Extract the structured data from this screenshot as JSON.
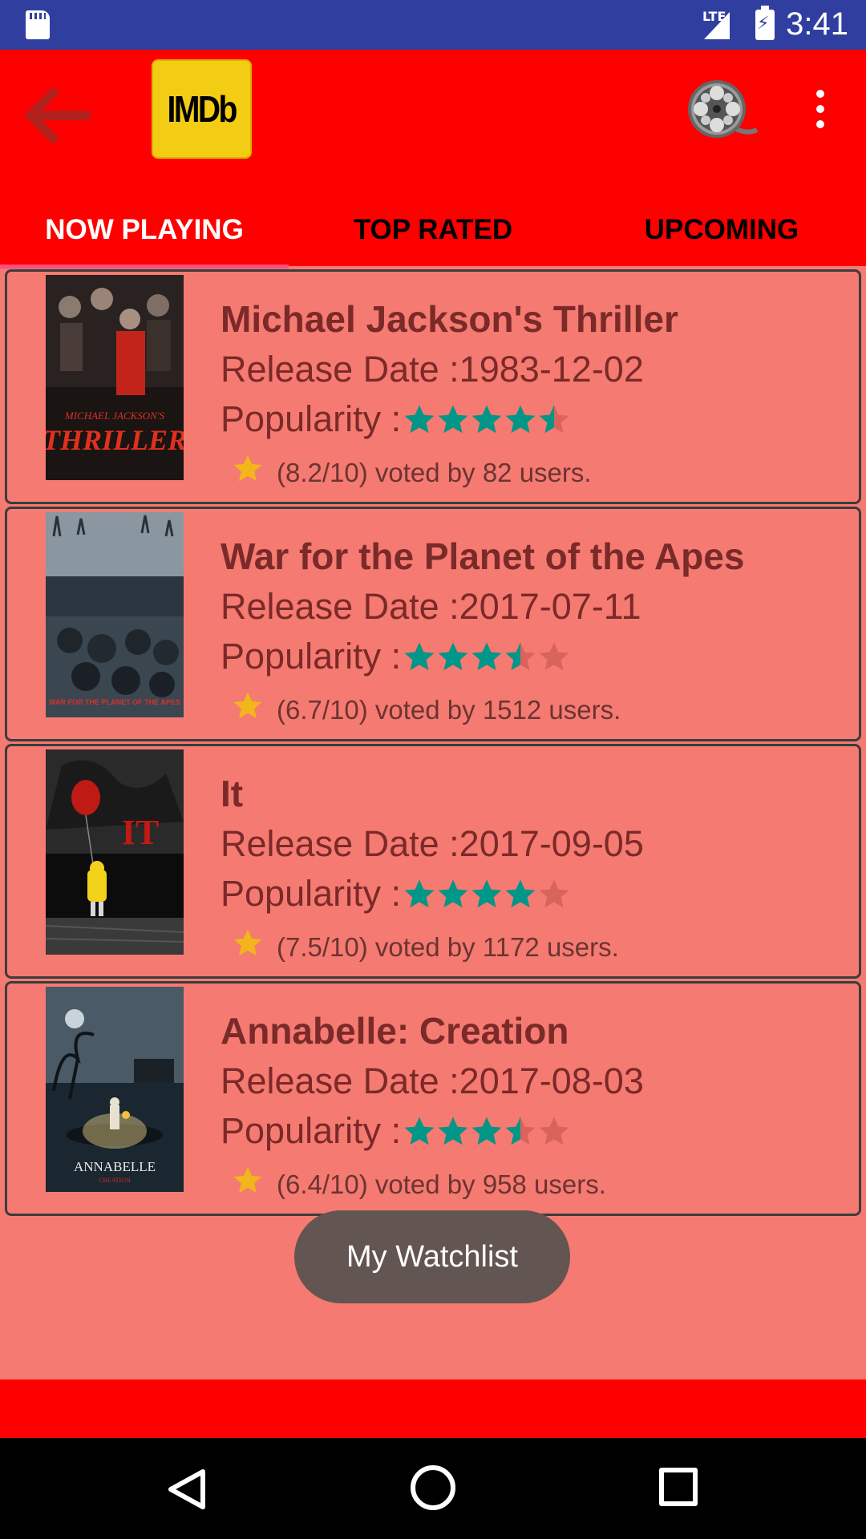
{
  "status_bar": {
    "time": "3:41",
    "network": "LTE",
    "icons": [
      "sd-card-icon",
      "lte-signal-icon",
      "battery-charging-icon"
    ]
  },
  "app_bar": {
    "back_icon": "arrow-left-icon",
    "logo_text": "IMDb",
    "reel_icon": "film-reel-icon",
    "overflow_icon": "more-vert-icon",
    "colors": {
      "app_bar": "#fe0000",
      "status_bar": "#303f9f",
      "background": "#f57a72",
      "tab_indicator": "#ff4d80"
    }
  },
  "tabs": [
    {
      "label": "NOW PLAYING",
      "active": true
    },
    {
      "label": "TOP RATED",
      "active": false
    },
    {
      "label": "UPCOMING",
      "active": false
    }
  ],
  "movies": [
    {
      "title": "Michael Jackson's Thriller",
      "release_label": "Release Date :",
      "release_date": "1983-12-02",
      "popularity_label": "Popularity :",
      "popularity_stars": 4.5,
      "vote_text": "(8.2/10) voted by 82 users."
    },
    {
      "title": "War for the Planet of the Apes",
      "release_label": "Release Date :",
      "release_date": "2017-07-11",
      "popularity_label": "Popularity :",
      "popularity_stars": 3.5,
      "vote_text": "(6.7/10) voted by 1512 users."
    },
    {
      "title": "It",
      "release_label": "Release Date :",
      "release_date": "2017-09-05",
      "popularity_label": "Popularity :",
      "popularity_stars": 4,
      "vote_text": "(7.5/10) voted by 1172 users."
    },
    {
      "title": "Annabelle: Creation",
      "release_label": "Release Date :",
      "release_date": "2017-08-03",
      "popularity_label": "Popularity :",
      "popularity_stars": 3.5,
      "vote_text": "(6.4/10) voted by 958 users."
    }
  ],
  "posters": {
    "thriller": {
      "text_line1": "MICHAEL JACKSON'S",
      "text_line2": "THRILLER"
    },
    "apes": {
      "text": "WAR FOR THE PLANET OF THE APES"
    },
    "it": {
      "text": "IT"
    },
    "annabelle": {
      "text_line1": "ANNABELLE",
      "text_line2": "CREATION"
    }
  },
  "toast": {
    "text": "My Watchlist"
  },
  "nav_bar": {
    "icons": [
      "nav-back-icon",
      "nav-home-icon",
      "nav-recents-icon"
    ]
  }
}
